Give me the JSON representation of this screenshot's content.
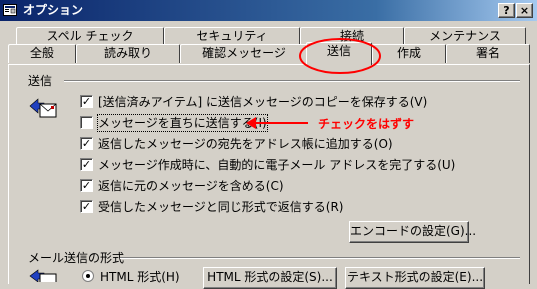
{
  "window": {
    "title": "オプション",
    "help_button": "?",
    "close_button": "×"
  },
  "tabs": {
    "row1": [
      "スペル チェック",
      "セキュリティ",
      "接続",
      "メンテナンス"
    ],
    "row2": [
      "全般",
      "読み取り",
      "確認メッセージ",
      "送信",
      "作成",
      "署名"
    ],
    "active": "送信"
  },
  "send_section": {
    "title": "送信",
    "options": [
      {
        "label": "[送信済みアイテム] に送信メッセージのコピーを保存する(V)",
        "checked": true
      },
      {
        "label": "メッセージを直ちに送信する(I)",
        "checked": false
      },
      {
        "label": "返信したメッセージの宛先をアドレス帳に追加する(O)",
        "checked": true
      },
      {
        "label": "メッセージ作成時に、自動的に電子メール アドレスを完了する(U)",
        "checked": true
      },
      {
        "label": "返信に元のメッセージを含める(C)",
        "checked": true
      },
      {
        "label": "受信したメッセージと同じ形式で返信する(R)",
        "checked": true
      }
    ],
    "encode_button": "エンコードの設定(G)..."
  },
  "format_section": {
    "title": "メール送信の形式",
    "radio_html": "HTML 形式(H)",
    "html_settings_button": "HTML 形式の設定(S)...",
    "text_settings_button": "テキスト形式の設定(E)..."
  },
  "annotation": {
    "text": "チェックをはずす",
    "color": "#ff0000"
  },
  "colors": {
    "title_bar": "#0a246a",
    "face": "#d4d0c8"
  }
}
